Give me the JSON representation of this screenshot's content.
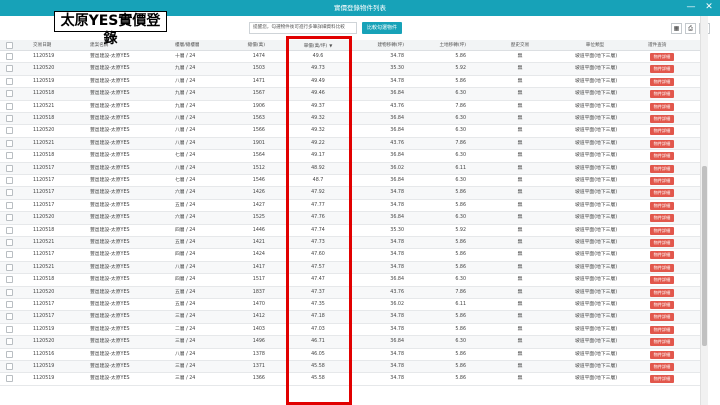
{
  "window": {
    "title": "實價登錄物件列表",
    "min_label": "—",
    "close_label": "✕"
  },
  "overlay_label": "太原YES實價登錄",
  "toolbar": {
    "note_placeholder": "提醒您，勾選物件後可進行多筆詳細資料比較",
    "compare_label": "比較勾選物件",
    "icons": [
      "grid-icon",
      "print-icon",
      "download-icon"
    ]
  },
  "columns": {
    "date": "交易日期",
    "project": "建案名稱",
    "floor": "樓層/總樓層",
    "total": "總價(萬)",
    "unit": "單價(萬/坪)",
    "build": "建物移轉(坪)",
    "land": "土地移轉(坪)",
    "presale": "歷史交易",
    "use": "車位類型",
    "cert": "證件查詢"
  },
  "rows": [
    {
      "date": "1120519",
      "project": "豐邑建設-太原YES",
      "floor": "十層 / 24",
      "total": "1474",
      "unit": "49.6",
      "build": "34.78",
      "land": "5.86",
      "presale": "無",
      "use": "坡道平面(地下三層)",
      "cert": "物件詳細"
    },
    {
      "date": "1120520",
      "project": "豐邑建設-太原YES",
      "floor": "九層 / 24",
      "total": "1503",
      "unit": "49.73",
      "build": "35.30",
      "land": "5.92",
      "presale": "無",
      "use": "坡道平面(地下三層)",
      "cert": "物件詳細"
    },
    {
      "date": "1120519",
      "project": "豐邑建設-太原YES",
      "floor": "八層 / 24",
      "total": "1471",
      "unit": "49.49",
      "build": "34.78",
      "land": "5.86",
      "presale": "無",
      "use": "坡道平面(地下三層)",
      "cert": "物件詳細"
    },
    {
      "date": "1120518",
      "project": "豐邑建設-太原YES",
      "floor": "九層 / 24",
      "total": "1567",
      "unit": "49.46",
      "build": "36.84",
      "land": "6.30",
      "presale": "無",
      "use": "坡道平面(地下三層)",
      "cert": "物件詳細"
    },
    {
      "date": "1120521",
      "project": "豐邑建設-太原YES",
      "floor": "九層 / 24",
      "total": "1906",
      "unit": "49.37",
      "build": "43.76",
      "land": "7.86",
      "presale": "無",
      "use": "坡道平面(地下三層)",
      "cert": "物件詳細"
    },
    {
      "date": "1120518",
      "project": "豐邑建設-太原YES",
      "floor": "八層 / 24",
      "total": "1563",
      "unit": "49.32",
      "build": "36.84",
      "land": "6.30",
      "presale": "無",
      "use": "坡道平面(地下三層)",
      "cert": "物件詳細"
    },
    {
      "date": "1120520",
      "project": "豐邑建設-太原YES",
      "floor": "八層 / 24",
      "total": "1566",
      "unit": "49.32",
      "build": "36.84",
      "land": "6.30",
      "presale": "無",
      "use": "坡道平面(地下三層)",
      "cert": "物件詳細"
    },
    {
      "date": "1120521",
      "project": "豐邑建設-太原YES",
      "floor": "八層 / 24",
      "total": "1901",
      "unit": "49.22",
      "build": "43.76",
      "land": "7.86",
      "presale": "無",
      "use": "坡道平面(地下三層)",
      "cert": "物件詳細"
    },
    {
      "date": "1120518",
      "project": "豐邑建設-太原YES",
      "floor": "七層 / 24",
      "total": "1564",
      "unit": "49.17",
      "build": "36.84",
      "land": "6.30",
      "presale": "無",
      "use": "坡道平面(地下三層)",
      "cert": "物件詳細"
    },
    {
      "date": "1120517",
      "project": "豐邑建設-太原YES",
      "floor": "八層 / 24",
      "total": "1512",
      "unit": "48.92",
      "build": "36.02",
      "land": "6.11",
      "presale": "無",
      "use": "坡道平面(地下三層)",
      "cert": "物件詳細"
    },
    {
      "date": "1120517",
      "project": "豐邑建設-太原YES",
      "floor": "七層 / 24",
      "total": "1546",
      "unit": "48.7",
      "build": "36.84",
      "land": "6.30",
      "presale": "無",
      "use": "坡道平面(地下三層)",
      "cert": "物件詳細"
    },
    {
      "date": "1120517",
      "project": "豐邑建設-太原YES",
      "floor": "六層 / 24",
      "total": "1426",
      "unit": "47.92",
      "build": "34.78",
      "land": "5.86",
      "presale": "無",
      "use": "坡道平面(地下三層)",
      "cert": "物件詳細"
    },
    {
      "date": "1120517",
      "project": "豐邑建設-太原YES",
      "floor": "五層 / 24",
      "total": "1427",
      "unit": "47.77",
      "build": "34.78",
      "land": "5.86",
      "presale": "無",
      "use": "坡道平面(地下三層)",
      "cert": "物件詳細"
    },
    {
      "date": "1120520",
      "project": "豐邑建設-太原YES",
      "floor": "六層 / 24",
      "total": "1525",
      "unit": "47.76",
      "build": "36.84",
      "land": "6.30",
      "presale": "無",
      "use": "坡道平面(地下三層)",
      "cert": "物件詳細"
    },
    {
      "date": "1120518",
      "project": "豐邑建設-太原YES",
      "floor": "四層 / 24",
      "total": "1446",
      "unit": "47.74",
      "build": "35.30",
      "land": "5.92",
      "presale": "無",
      "use": "坡道平面(地下三層)",
      "cert": "物件詳細"
    },
    {
      "date": "1120521",
      "project": "豐邑建設-太原YES",
      "floor": "五層 / 24",
      "total": "1421",
      "unit": "47.73",
      "build": "34.78",
      "land": "5.86",
      "presale": "無",
      "use": "坡道平面(地下三層)",
      "cert": "物件詳細"
    },
    {
      "date": "1120517",
      "project": "豐邑建設-太原YES",
      "floor": "四層 / 24",
      "total": "1424",
      "unit": "47.60",
      "build": "34.78",
      "land": "5.86",
      "presale": "無",
      "use": "坡道平面(地下三層)",
      "cert": "物件詳細"
    },
    {
      "date": "1120521",
      "project": "豐邑建設-太原YES",
      "floor": "八層 / 24",
      "total": "1417",
      "unit": "47.57",
      "build": "34.78",
      "land": "5.86",
      "presale": "無",
      "use": "坡道平面(地下三層)",
      "cert": "物件詳細"
    },
    {
      "date": "1120518",
      "project": "豐邑建設-太原YES",
      "floor": "四層 / 24",
      "total": "1517",
      "unit": "47.47",
      "build": "36.84",
      "land": "6.30",
      "presale": "無",
      "use": "坡道平面(地下三層)",
      "cert": "物件詳細"
    },
    {
      "date": "1120520",
      "project": "豐邑建設-太原YES",
      "floor": "五層 / 24",
      "total": "1837",
      "unit": "47.37",
      "build": "43.76",
      "land": "7.86",
      "presale": "無",
      "use": "坡道平面(地下三層)",
      "cert": "物件詳細"
    },
    {
      "date": "1120517",
      "project": "豐邑建設-太原YES",
      "floor": "五層 / 24",
      "total": "1470",
      "unit": "47.35",
      "build": "36.02",
      "land": "6.11",
      "presale": "無",
      "use": "坡道平面(地下三層)",
      "cert": "物件詳細"
    },
    {
      "date": "1120517",
      "project": "豐邑建設-太原YES",
      "floor": "三層 / 24",
      "total": "1412",
      "unit": "47.18",
      "build": "34.78",
      "land": "5.86",
      "presale": "無",
      "use": "坡道平面(地下三層)",
      "cert": "物件詳細"
    },
    {
      "date": "1120519",
      "project": "豐邑建設-太原YES",
      "floor": "二層 / 24",
      "total": "1403",
      "unit": "47.03",
      "build": "34.78",
      "land": "5.86",
      "presale": "無",
      "use": "坡道平面(地下三層)",
      "cert": "物件詳細"
    },
    {
      "date": "1120520",
      "project": "豐邑建設-太原YES",
      "floor": "三層 / 24",
      "total": "1496",
      "unit": "46.71",
      "build": "36.84",
      "land": "6.30",
      "presale": "無",
      "use": "坡道平面(地下三層)",
      "cert": "物件詳細"
    },
    {
      "date": "1120516",
      "project": "豐邑建設-太原YES",
      "floor": "八層 / 24",
      "total": "1378",
      "unit": "46.05",
      "build": "34.78",
      "land": "5.86",
      "presale": "無",
      "use": "坡道平面(地下三層)",
      "cert": "物件詳細"
    },
    {
      "date": "1120519",
      "project": "豐邑建設-太原YES",
      "floor": "三層 / 24",
      "total": "1371",
      "unit": "45.58",
      "build": "34.78",
      "land": "5.86",
      "presale": "無",
      "use": "坡道平面(地下三層)",
      "cert": "物件詳細"
    },
    {
      "date": "1120519",
      "project": "豐邑建設-太原YES",
      "floor": "三層 / 24",
      "total": "1366",
      "unit": "45.58",
      "build": "34.78",
      "land": "5.86",
      "presale": "無",
      "use": "坡道平面(地下三層)",
      "cert": "物件詳細"
    }
  ],
  "colors": {
    "titlebar": "#17a2b8",
    "badge": "#e2574c",
    "highlight": "#e10000"
  }
}
